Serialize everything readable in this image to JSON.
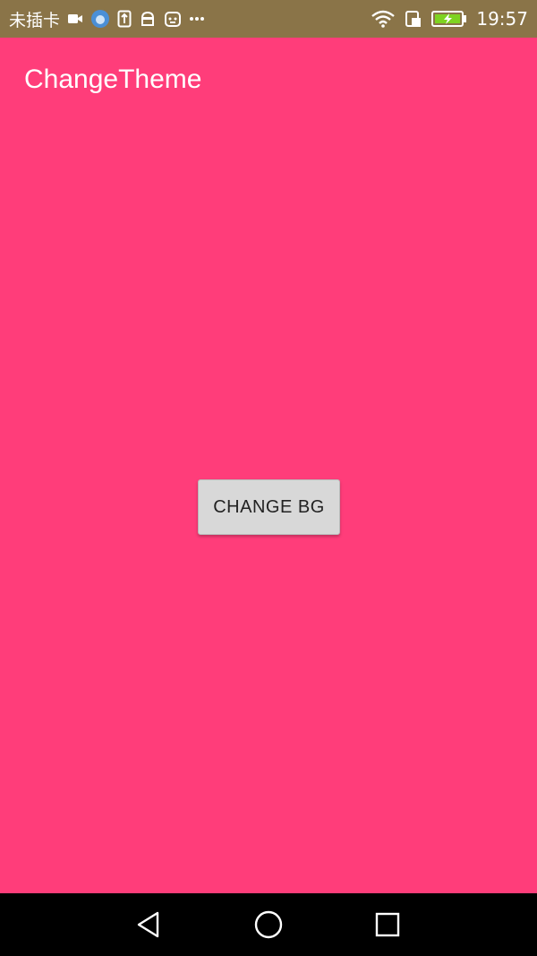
{
  "status_bar": {
    "carrier": "未插卡",
    "time": "19:57",
    "icons": [
      "video-icon",
      "baidu-icon",
      "upload-icon",
      "android-icon",
      "robot-icon",
      "more-icon",
      "wifi-icon",
      "sim-icon",
      "battery-charging-icon"
    ]
  },
  "app_bar": {
    "title": "ChangeTheme"
  },
  "content": {
    "button_label": "CHANGE BG"
  },
  "nav_bar": {
    "icons": [
      "back-icon",
      "home-icon",
      "recents-icon"
    ]
  },
  "colors": {
    "primary": "#ff3d7a",
    "status_bar": "#8a7448",
    "button": "#d8d8d8"
  }
}
